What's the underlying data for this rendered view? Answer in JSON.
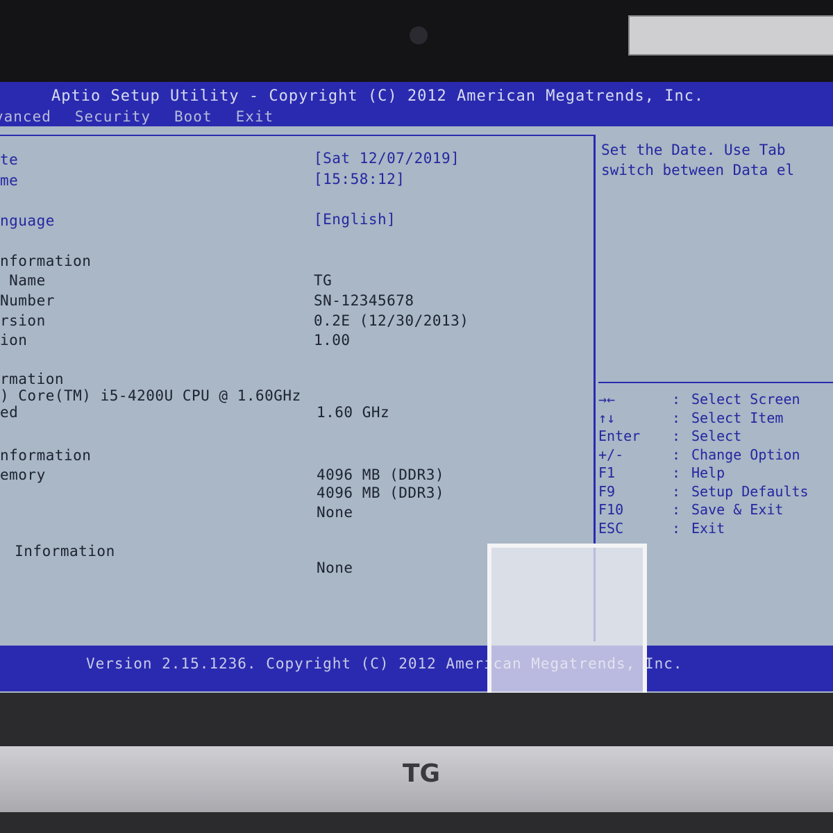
{
  "header": {
    "title": "Aptio Setup Utility - Copyright (C) 2012 American Megatrends, Inc.",
    "tabs": [
      "vanced",
      "Security",
      "Boot",
      "Exit"
    ]
  },
  "main": {
    "items": [
      {
        "label": "te",
        "value": "[Sat 12/07/2019]"
      },
      {
        "label": "me",
        "value": "[15:58:12]"
      },
      {
        "label": "nguage",
        "value": "[English]"
      },
      {
        "label": "nformation",
        "value": ""
      },
      {
        "label": " Name",
        "value": "TG"
      },
      {
        "label": "Number",
        "value": "SN-12345678"
      },
      {
        "label": "rsion",
        "value": "0.2E (12/30/2013)"
      },
      {
        "label": "ion",
        "value": "1.00"
      },
      {
        "label": "rmation",
        "value": ""
      },
      {
        "label": ") Core(TM) i5-4200U CPU @ 1.60GHz",
        "value": ""
      },
      {
        "label": "ed",
        "value": "1.60 GHz"
      },
      {
        "label": "nformation",
        "value": ""
      },
      {
        "label": "emory",
        "value": "4096 MB (DDR3)"
      },
      {
        "label": "",
        "value": "4096 MB (DDR3)"
      },
      {
        "label": "",
        "value": "None"
      },
      {
        "label": " Information",
        "value": ""
      },
      {
        "label": "",
        "value": "None"
      }
    ]
  },
  "help": {
    "text": "Set the Date. Use Tab\nswitch between Data el"
  },
  "keys": [
    {
      "key": "→←",
      "desc": "Select Screen"
    },
    {
      "key": "↑↓",
      "desc": "Select Item"
    },
    {
      "key": "Enter",
      "desc": "Select"
    },
    {
      "key": "+/-",
      "desc": "Change Option"
    },
    {
      "key": "F1",
      "desc": "Help"
    },
    {
      "key": "F9",
      "desc": "Setup Defaults"
    },
    {
      "key": "F10",
      "desc": "Save & Exit"
    },
    {
      "key": "ESC",
      "desc": "Exit"
    }
  ],
  "footer": {
    "text": "Version 2.15.1236. Copyright (C) 2012 American Megatrends, Inc."
  },
  "bezel": {
    "logo": "TG"
  },
  "colors": {
    "bios_blue": "#2a2ab0",
    "panel": "#a9b7c6"
  }
}
